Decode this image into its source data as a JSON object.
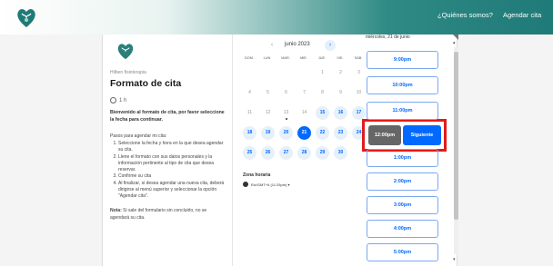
{
  "nav": {
    "about": "¿Quiénes somos?",
    "book": "Agendar cita"
  },
  "org": "Hilben fisioterapia",
  "title": "Formato de cita",
  "duration": "1 h",
  "intro": "Bienvenido al formato de cita, por favor seleccione la fecha para continuar.",
  "steps_title": "Pasos para agendar mi cita:",
  "steps": [
    "Seleccione la fecha y hora en la que desea agendar su cita.",
    "Llene el formato con sus datos personales y la información pertinente al tipo de cita que desea reservar.",
    "Confirme su cita",
    "Al finalizar, si desea agendar una nueva cita, deberá dirigirse al menú superior y seleccionar la opción \"Agendar cita\"."
  ],
  "note_label": "Nota:",
  "note": " Si sale del formulario sin concluirlo, no se agendará su cita.",
  "calendar": {
    "month": "junio 2023",
    "weekdays": [
      "DOM.",
      "LUN.",
      "MAR.",
      "MIÉ.",
      "JUE.",
      "VIE.",
      "SÁB."
    ],
    "weeks": [
      [
        "",
        "",
        "",
        "",
        "1",
        "2",
        "3"
      ],
      [
        "4",
        "5",
        "6",
        "7",
        "8",
        "9",
        "10"
      ],
      [
        "11",
        "12",
        "13",
        "14",
        "15",
        "16",
        "17"
      ],
      [
        "18",
        "19",
        "20",
        "21",
        "22",
        "23",
        "24"
      ],
      [
        "25",
        "26",
        "27",
        "28",
        "29",
        "30",
        ""
      ]
    ],
    "available": [
      "15",
      "16",
      "17",
      "18",
      "19",
      "20",
      "22",
      "23",
      "24",
      "25",
      "26",
      "27",
      "28",
      "29",
      "30"
    ],
    "selected": "21",
    "today": "13"
  },
  "timezone_label": "Zona horaria",
  "timezone": "Etc/GMT+6 (11:25pm) ▾",
  "selected_date": "miércoles, 21 de junio",
  "slots": [
    "9:00pm",
    "10:00pm",
    "11:00pm",
    "1:00pm",
    "2:00pm",
    "3:00pm",
    "4:00pm",
    "5:00pm"
  ],
  "selected_slot": "12:00pm",
  "confirm_label": "Siguiente",
  "colors": {
    "accent": "#0069ff",
    "highlight": "#e21b1b",
    "brand": "#1f7a78"
  }
}
